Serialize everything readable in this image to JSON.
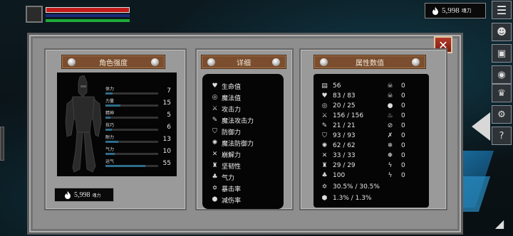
{
  "hud": {
    "currency_top_value": "5,998",
    "currency_unit": "魂力"
  },
  "panels": {
    "character_title": "角色强度",
    "details_title": "详细",
    "values_title": "属性数值"
  },
  "attributes": [
    {
      "label": "体力",
      "value": "7",
      "fill": 0.14
    },
    {
      "label": "力量",
      "value": "15",
      "fill": 0.28
    },
    {
      "label": "精神",
      "value": "5",
      "fill": 0.1
    },
    {
      "label": "技巧",
      "value": "6",
      "fill": 0.12
    },
    {
      "label": "耐力",
      "value": "13",
      "fill": 0.24
    },
    {
      "label": "气力",
      "value": "10",
      "fill": 0.18
    },
    {
      "label": "运气",
      "value": "55",
      "fill": 0.75
    }
  ],
  "currency_bottom_value": "5,998",
  "details": [
    {
      "icon": "heart-icon",
      "label": "生命值"
    },
    {
      "icon": "mana-icon",
      "label": "魔法值"
    },
    {
      "icon": "sword-icon",
      "label": "攻击力"
    },
    {
      "icon": "magic-attack-icon",
      "label": "魔法攻击力"
    },
    {
      "icon": "shield-icon",
      "label": "防御力"
    },
    {
      "icon": "magic-defense-icon",
      "label": "魔法防御力"
    },
    {
      "icon": "break-icon",
      "label": "崩解力"
    },
    {
      "icon": "tenacity-icon",
      "label": "坚韧性"
    },
    {
      "icon": "lungs-icon",
      "label": "气力"
    },
    {
      "icon": "crit-icon",
      "label": "暴击率"
    },
    {
      "icon": "damage-reduction-icon",
      "label": "减伤率"
    }
  ],
  "values": [
    "56",
    "83 / 83",
    "20 / 25",
    "156 / 156",
    "21 / 21",
    "93 / 93",
    "62 / 62",
    "33 / 33",
    "29 / 29",
    "100",
    "30.5% / 30.5%",
    "1.3% / 1.3%"
  ],
  "resistances": [
    {
      "icon": "skull-icon",
      "value": "0"
    },
    {
      "icon": "skull-crossbones-icon",
      "value": "0"
    },
    {
      "icon": "drop-icon",
      "value": "0"
    },
    {
      "icon": "fire-icon",
      "value": "0"
    },
    {
      "icon": "fire-slash-icon",
      "value": "0"
    },
    {
      "icon": "tools-icon",
      "value": "0"
    },
    {
      "icon": "snowflake-icon",
      "value": "0"
    },
    {
      "icon": "snowflake-alt-icon",
      "value": "0"
    },
    {
      "icon": "lightning-icon",
      "value": "0"
    },
    {
      "icon": "lightning-alt-icon",
      "value": "0"
    }
  ]
}
